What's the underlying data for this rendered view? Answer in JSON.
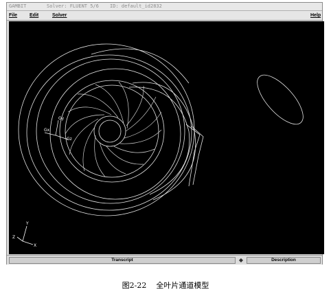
{
  "window": {
    "title_segments": [
      "GAMBIT",
      "Solver: FLUENT 5/6",
      "ID: default_id2832"
    ]
  },
  "menu": {
    "file": "File",
    "edit": "Edit",
    "solver": "Solver",
    "help": "Help"
  },
  "viewport": {
    "origin_labels": {
      "gy": "Gy",
      "gx": "Gx",
      "gz": "Gz"
    },
    "axis_labels": {
      "x": "X",
      "y": "Y",
      "z": "Z"
    }
  },
  "bottom": {
    "transcript": "Transcript",
    "description": "Description"
  },
  "caption": {
    "number": "图2-22",
    "text": "全叶片通道模型"
  }
}
